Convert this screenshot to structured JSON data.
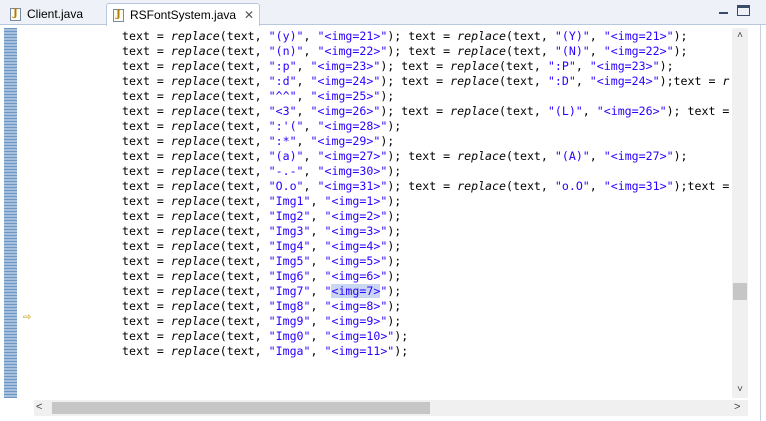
{
  "tabs": [
    {
      "label": "Client.java",
      "icon": "java-file-icon"
    },
    {
      "label": "RSFontSystem.java",
      "icon": "java-file-icon",
      "close": "✕"
    }
  ],
  "window_controls": {
    "minimize": "minimize-icon",
    "maximize": "maximize-icon"
  },
  "scroll": {
    "up": "˄",
    "down": "˅",
    "left": "<",
    "right": ">"
  },
  "colors": {
    "string": "#2a00ff",
    "highlight": "#c8d6f2",
    "gutter": "#6f97c4"
  },
  "current_line_index": 17,
  "selected_text": "<img=7>",
  "code_lines": [
    [
      [
        "text = ",
        ""
      ],
      [
        "replace",
        "fn"
      ],
      [
        "(text, ",
        ""
      ],
      [
        "\"(y)\"",
        "s"
      ],
      [
        ", ",
        ""
      ],
      [
        "\"<img=21>\"",
        "s"
      ],
      [
        "); text = ",
        ""
      ],
      [
        "replace",
        "fn"
      ],
      [
        "(text, ",
        ""
      ],
      [
        "\"(Y)\"",
        "s"
      ],
      [
        ", ",
        ""
      ],
      [
        "\"<img=21>\"",
        "s"
      ],
      [
        ");",
        ""
      ]
    ],
    [
      [
        "text = ",
        ""
      ],
      [
        "replace",
        "fn"
      ],
      [
        "(text, ",
        ""
      ],
      [
        "\"(n)\"",
        "s"
      ],
      [
        ", ",
        ""
      ],
      [
        "\"<img=22>\"",
        "s"
      ],
      [
        "); text = ",
        ""
      ],
      [
        "replace",
        "fn"
      ],
      [
        "(text, ",
        ""
      ],
      [
        "\"(N)\"",
        "s"
      ],
      [
        ", ",
        ""
      ],
      [
        "\"<img=22>\"",
        "s"
      ],
      [
        ");",
        ""
      ]
    ],
    [
      [
        "text = ",
        ""
      ],
      [
        "replace",
        "fn"
      ],
      [
        "(text, ",
        ""
      ],
      [
        "\":p\"",
        "s"
      ],
      [
        ", ",
        ""
      ],
      [
        "\"<img=23>\"",
        "s"
      ],
      [
        "); text = ",
        ""
      ],
      [
        "replace",
        "fn"
      ],
      [
        "(text, ",
        ""
      ],
      [
        "\":P\"",
        "s"
      ],
      [
        ", ",
        ""
      ],
      [
        "\"<img=23>\"",
        "s"
      ],
      [
        ");",
        ""
      ]
    ],
    [
      [
        "text = ",
        ""
      ],
      [
        "replace",
        "fn"
      ],
      [
        "(text, ",
        ""
      ],
      [
        "\":d\"",
        "s"
      ],
      [
        ", ",
        ""
      ],
      [
        "\"<img=24>\"",
        "s"
      ],
      [
        "); text = ",
        ""
      ],
      [
        "replace",
        "fn"
      ],
      [
        "(text, ",
        ""
      ],
      [
        "\":D\"",
        "s"
      ],
      [
        ", ",
        ""
      ],
      [
        "\"<img=24>\"",
        "s"
      ],
      [
        ");text = ",
        ""
      ],
      [
        "r",
        "fn"
      ]
    ],
    [
      [
        "text = ",
        ""
      ],
      [
        "replace",
        "fn"
      ],
      [
        "(text, ",
        ""
      ],
      [
        "\"^^\"",
        "s"
      ],
      [
        ", ",
        ""
      ],
      [
        "\"<img=25>\"",
        "s"
      ],
      [
        ");",
        ""
      ]
    ],
    [
      [
        "text = ",
        ""
      ],
      [
        "replace",
        "fn"
      ],
      [
        "(text, ",
        ""
      ],
      [
        "\"<3\"",
        "s"
      ],
      [
        ", ",
        ""
      ],
      [
        "\"<img=26>\"",
        "s"
      ],
      [
        "); text = ",
        ""
      ],
      [
        "replace",
        "fn"
      ],
      [
        "(text, ",
        ""
      ],
      [
        "\"(L)\"",
        "s"
      ],
      [
        ", ",
        ""
      ],
      [
        "\"<img=26>\"",
        "s"
      ],
      [
        "); text =",
        ""
      ]
    ],
    [
      [
        "text = ",
        ""
      ],
      [
        "replace",
        "fn"
      ],
      [
        "(text, ",
        ""
      ],
      [
        "\":'(\"",
        "s"
      ],
      [
        ", ",
        ""
      ],
      [
        "\"<img=28>\"",
        "s"
      ],
      [
        ");",
        ""
      ]
    ],
    [
      [
        "text = ",
        ""
      ],
      [
        "replace",
        "fn"
      ],
      [
        "(text, ",
        ""
      ],
      [
        "\":*\"",
        "s"
      ],
      [
        ", ",
        ""
      ],
      [
        "\"<img=29>\"",
        "s"
      ],
      [
        ");",
        ""
      ]
    ],
    [
      [
        "text = ",
        ""
      ],
      [
        "replace",
        "fn"
      ],
      [
        "(text, ",
        ""
      ],
      [
        "\"(a)\"",
        "s"
      ],
      [
        ", ",
        ""
      ],
      [
        "\"<img=27>\"",
        "s"
      ],
      [
        "); text = ",
        ""
      ],
      [
        "replace",
        "fn"
      ],
      [
        "(text, ",
        ""
      ],
      [
        "\"(A)\"",
        "s"
      ],
      [
        ", ",
        ""
      ],
      [
        "\"<img=27>\"",
        "s"
      ],
      [
        ");",
        ""
      ]
    ],
    [
      [
        "text = ",
        ""
      ],
      [
        "replace",
        "fn"
      ],
      [
        "(text, ",
        ""
      ],
      [
        "\"-.-\"",
        "s"
      ],
      [
        ", ",
        ""
      ],
      [
        "\"<img=30>\"",
        "s"
      ],
      [
        ");",
        ""
      ]
    ],
    [
      [
        "text = ",
        ""
      ],
      [
        "replace",
        "fn"
      ],
      [
        "(text, ",
        ""
      ],
      [
        "\"O.o\"",
        "s"
      ],
      [
        ", ",
        ""
      ],
      [
        "\"<img=31>\"",
        "s"
      ],
      [
        "); text = ",
        ""
      ],
      [
        "replace",
        "fn"
      ],
      [
        "(text, ",
        ""
      ],
      [
        "\"o.O\"",
        "s"
      ],
      [
        ", ",
        ""
      ],
      [
        "\"<img=31>\"",
        "s"
      ],
      [
        ");text =",
        ""
      ]
    ],
    [
      [
        "text = ",
        ""
      ],
      [
        "replace",
        "fn"
      ],
      [
        "(text, ",
        ""
      ],
      [
        "\"Img1\"",
        "s"
      ],
      [
        ", ",
        ""
      ],
      [
        "\"<img=1>\"",
        "s"
      ],
      [
        ");",
        ""
      ]
    ],
    [
      [
        "text = ",
        ""
      ],
      [
        "replace",
        "fn"
      ],
      [
        "(text, ",
        ""
      ],
      [
        "\"Img2\"",
        "s"
      ],
      [
        ", ",
        ""
      ],
      [
        "\"<img=2>\"",
        "s"
      ],
      [
        ");",
        ""
      ]
    ],
    [
      [
        "text = ",
        ""
      ],
      [
        "replace",
        "fn"
      ],
      [
        "(text, ",
        ""
      ],
      [
        "\"Img3\"",
        "s"
      ],
      [
        ", ",
        ""
      ],
      [
        "\"<img=3>\"",
        "s"
      ],
      [
        ");",
        ""
      ]
    ],
    [
      [
        "text = ",
        ""
      ],
      [
        "replace",
        "fn"
      ],
      [
        "(text, ",
        ""
      ],
      [
        "\"Img4\"",
        "s"
      ],
      [
        ", ",
        ""
      ],
      [
        "\"<img=4>\"",
        "s"
      ],
      [
        ");",
        ""
      ]
    ],
    [
      [
        "text = ",
        ""
      ],
      [
        "replace",
        "fn"
      ],
      [
        "(text, ",
        ""
      ],
      [
        "\"Img5\"",
        "s"
      ],
      [
        ", ",
        ""
      ],
      [
        "\"<img=5>\"",
        "s"
      ],
      [
        ");",
        ""
      ]
    ],
    [
      [
        "text = ",
        ""
      ],
      [
        "replace",
        "fn"
      ],
      [
        "(text, ",
        ""
      ],
      [
        "\"Img6\"",
        "s"
      ],
      [
        ", ",
        ""
      ],
      [
        "\"<img=6>\"",
        "s"
      ],
      [
        ");",
        ""
      ]
    ],
    [
      [
        "text = ",
        ""
      ],
      [
        "replace",
        "fn"
      ],
      [
        "(text, ",
        ""
      ],
      [
        "\"Img7\"",
        "s"
      ],
      [
        ", ",
        ""
      ],
      [
        "\"",
        "s"
      ],
      [
        "<img=7>",
        "s hl"
      ],
      [
        "\"",
        "s"
      ],
      [
        ");",
        ""
      ]
    ],
    [
      [
        "text = ",
        ""
      ],
      [
        "replace",
        "fn"
      ],
      [
        "(text, ",
        ""
      ],
      [
        "\"Img8\"",
        "s"
      ],
      [
        ", ",
        ""
      ],
      [
        "\"<img=8>\"",
        "s"
      ],
      [
        ");",
        ""
      ]
    ],
    [
      [
        "text = ",
        ""
      ],
      [
        "replace",
        "fn"
      ],
      [
        "(text, ",
        ""
      ],
      [
        "\"Img9\"",
        "s"
      ],
      [
        ", ",
        ""
      ],
      [
        "\"<img=9>\"",
        "s"
      ],
      [
        ");",
        ""
      ]
    ],
    [
      [
        "text = ",
        ""
      ],
      [
        "replace",
        "fn"
      ],
      [
        "(text, ",
        ""
      ],
      [
        "\"Img0\"",
        "s"
      ],
      [
        ", ",
        ""
      ],
      [
        "\"<img=10>\"",
        "s"
      ],
      [
        ");",
        ""
      ]
    ],
    [
      [
        "text = ",
        ""
      ],
      [
        "replace",
        "fn"
      ],
      [
        "(text, ",
        ""
      ],
      [
        "\"Imga\"",
        "s"
      ],
      [
        ", ",
        ""
      ],
      [
        "\"<img=11>\"",
        "s"
      ],
      [
        ");",
        ""
      ]
    ]
  ]
}
